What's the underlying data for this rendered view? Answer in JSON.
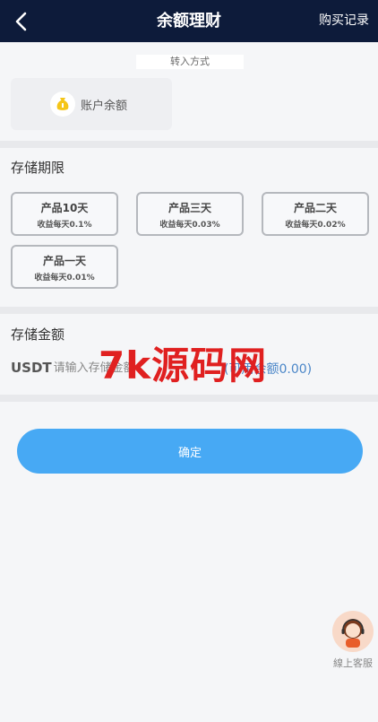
{
  "header": {
    "title": "余额理财",
    "right_link": "购买记录"
  },
  "method": {
    "title": "转入方式",
    "balance_option": "账户余额"
  },
  "storage_period": {
    "title": "存储期限",
    "products": [
      {
        "name": "产品10天",
        "rate": "收益每天0.1%"
      },
      {
        "name": "产品三天",
        "rate": "收益每天0.03%"
      },
      {
        "name": "产品二天",
        "rate": "收益每天0.02%"
      },
      {
        "name": "产品一天",
        "rate": "收益每天0.01%"
      }
    ]
  },
  "storage_amount": {
    "title": "存储金额",
    "currency": "USDT",
    "input_placeholder": "请输入存储金额",
    "available_text": "(可用余额0.00)"
  },
  "watermark": "7k源码网",
  "confirm_label": "确定",
  "support_label": "線上客服",
  "colors": {
    "header_bg": "#0d1b3a",
    "confirm_bg": "#47a9f4",
    "watermark": "#e02020"
  }
}
